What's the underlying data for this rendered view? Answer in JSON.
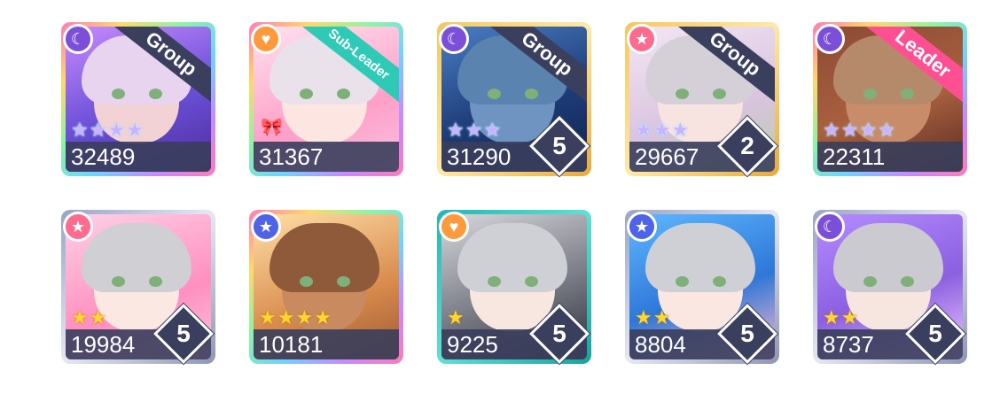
{
  "cards": [
    {
      "power": "32489",
      "attribute": "cool",
      "attribute_icon": "crescent-moon-icon",
      "ribbon": "Group",
      "ribbon_color": "#3a3f5e",
      "stars": 4,
      "star_type": "trained",
      "level": "",
      "frame": "rainbow",
      "art": "purple"
    },
    {
      "power": "31367",
      "attribute": "happy",
      "attribute_icon": "heart-icon",
      "ribbon": "Sub-Leader",
      "ribbon_color": "#2fcab6",
      "stars": 0,
      "star_type": "bow",
      "level": "",
      "frame": "rainbow",
      "art": "pink"
    },
    {
      "power": "31290",
      "attribute": "cool",
      "attribute_icon": "crescent-moon-icon",
      "ribbon": "Group",
      "ribbon_color": "#3a3f5e",
      "stars": 3,
      "star_type": "trained",
      "level": "5",
      "frame": "gold",
      "art": "blue"
    },
    {
      "power": "29667",
      "attribute": "pure",
      "attribute_icon": "star-icon",
      "ribbon": "Group",
      "ribbon_color": "#3a3f5e",
      "stars": 3,
      "star_type": "trained",
      "level": "2",
      "frame": "gold",
      "art": "lavender"
    },
    {
      "power": "22311",
      "attribute": "cool",
      "attribute_icon": "crescent-moon-icon",
      "ribbon": "Leader",
      "ribbon_color": "#ff4f93",
      "stars": 4,
      "star_type": "trained",
      "level": "",
      "frame": "rainbow",
      "art": "brown"
    },
    {
      "power": "19984",
      "attribute": "pure",
      "attribute_icon": "star-icon",
      "ribbon": "",
      "stars": 2,
      "star_type": "normal",
      "level": "5",
      "frame": "silver",
      "art": "pinkwhite"
    },
    {
      "power": "10181",
      "attribute": "powerful",
      "attribute_icon": "star-icon",
      "ribbon": "",
      "stars": 4,
      "star_type": "normal",
      "level": "",
      "frame": "rainbow",
      "art": "warm"
    },
    {
      "power": "9225",
      "attribute": "happy",
      "attribute_icon": "heart-icon",
      "ribbon": "",
      "stars": 1,
      "star_type": "normal",
      "level": "5",
      "frame": "teal",
      "art": "dark"
    },
    {
      "power": "8804",
      "attribute": "powerful",
      "attribute_icon": "star-icon",
      "ribbon": "",
      "stars": 2,
      "star_type": "normal",
      "level": "5",
      "frame": "silver",
      "art": "sky"
    },
    {
      "power": "8737",
      "attribute": "cool",
      "attribute_icon": "crescent-moon-icon",
      "ribbon": "",
      "stars": 2,
      "star_type": "normal",
      "level": "5",
      "frame": "silver",
      "art": "violet"
    }
  ]
}
